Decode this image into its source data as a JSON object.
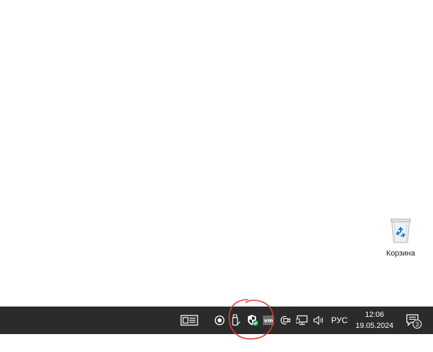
{
  "desktop": {
    "recycle_bin": {
      "label": "Корзина",
      "icon": "recycle-bin-icon"
    }
  },
  "taskbar": {
    "news_icon": "news-widget-icon",
    "tray": {
      "record_icon": "record-icon",
      "usb_icon": "usb-eject-icon",
      "security_icon": "windows-security-icon",
      "vm_icon": "vmware-tools-icon",
      "meet_icon": "meet-now-icon",
      "network_icon": "network-icon",
      "volume_icon": "volume-icon"
    },
    "language": "РУС",
    "time": "12:06",
    "date": "19.05.2024",
    "notifications": {
      "count": "3",
      "icon": "notification-center-icon"
    }
  },
  "annotation": {
    "color": "#e53935"
  }
}
